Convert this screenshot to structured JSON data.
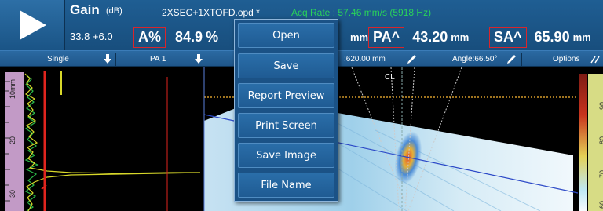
{
  "header": {
    "gain_title": "Gain",
    "gain_unit": "(dB)",
    "gain_value": "33.8 +6.0",
    "file_name": "2XSEC+1XTOFD.opd *",
    "acq_rate": "Acq Rate : 57.46 mm/s (5918 Hz)",
    "readings": [
      {
        "name": "A%",
        "value": "84.9",
        "unit": "%"
      },
      {
        "name": "PA^",
        "value": "43.20",
        "unit": "mm"
      },
      {
        "name": "SA^",
        "value": "65.90",
        "unit": "mm"
      }
    ],
    "hidden_unit": "mm"
  },
  "toolbar": {
    "single": "Single",
    "pa": "PA 1",
    "distance": ":620.00 mm",
    "angle": "Angle:66.50°",
    "options": "Options"
  },
  "display": {
    "cl_label": "CL",
    "left_ruler_ticks": [
      "10mm",
      "20",
      "30"
    ],
    "right_ruler_ticks": [
      "90",
      "80",
      "70",
      "60"
    ]
  },
  "context_menu": {
    "items": [
      "Open",
      "Save",
      "Report Preview",
      "Print Screen",
      "Save Image",
      "File Name"
    ]
  },
  "colors": {
    "header_blue": "#1f5e93",
    "acq_green": "#29d25a",
    "reading_box_red": "#d9252b",
    "ascan_yellow": "#d8d82a",
    "gate_red": "#e0251e"
  },
  "icons": [
    "play-icon",
    "down-arrow-icon",
    "pencil-icon",
    "options-arrows-icon"
  ]
}
